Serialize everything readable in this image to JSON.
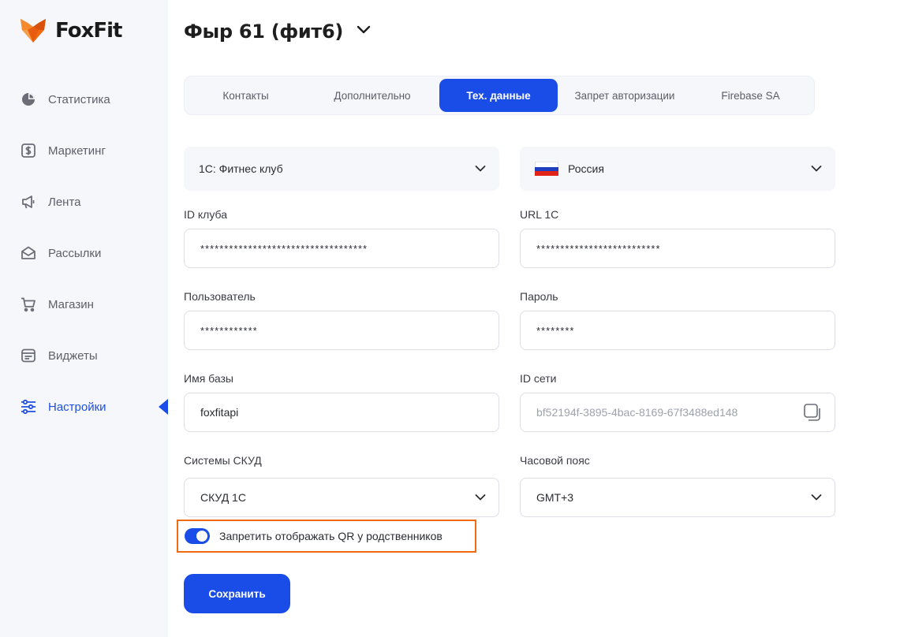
{
  "brand": {
    "name": "FoxFit"
  },
  "sidebar": {
    "items": [
      {
        "label": "Статистика",
        "icon": "pie-chart-icon"
      },
      {
        "label": "Маркетинг",
        "icon": "dollar-tag-icon"
      },
      {
        "label": "Лента",
        "icon": "megaphone-icon"
      },
      {
        "label": "Рассылки",
        "icon": "mail-icon"
      },
      {
        "label": "Магазин",
        "icon": "cart-icon"
      },
      {
        "label": "Виджеты",
        "icon": "widget-icon"
      },
      {
        "label": "Настройки",
        "icon": "sliders-icon",
        "active": true
      }
    ]
  },
  "header": {
    "title": "Фыр 61 (фит6)"
  },
  "tabs": [
    {
      "label": "Контакты"
    },
    {
      "label": "Дополнительно"
    },
    {
      "label": "Тех. данные",
      "active": true
    },
    {
      "label": "Запрет авторизации"
    },
    {
      "label": "Firebase SA"
    }
  ],
  "form": {
    "integration_select": {
      "value": "1С: Фитнес клуб"
    },
    "country_select": {
      "value": "Россия"
    },
    "club_id": {
      "label": "ID клуба",
      "value": "***********************************"
    },
    "url_1c": {
      "label": "URL 1С",
      "value": "**************************"
    },
    "user": {
      "label": "Пользователь",
      "value": "************"
    },
    "password": {
      "label": "Пароль",
      "value": "********"
    },
    "db_name": {
      "label": "Имя базы",
      "value": "foxfitapi"
    },
    "network_id": {
      "label": "ID сети",
      "value": "bf52194f-3895-4bac-8169-67f3488ed148"
    },
    "access_system": {
      "label": "Системы СКУД",
      "value": "СКУД 1С"
    },
    "timezone": {
      "label": "Часовой пояс",
      "value": "GMT+3"
    },
    "qr_toggle": {
      "label": "Запретить отображать QR у родственников",
      "on": true
    },
    "save_label": "Сохранить"
  },
  "colors": {
    "accent": "#1a4de8",
    "highlight": "#f06a12"
  }
}
